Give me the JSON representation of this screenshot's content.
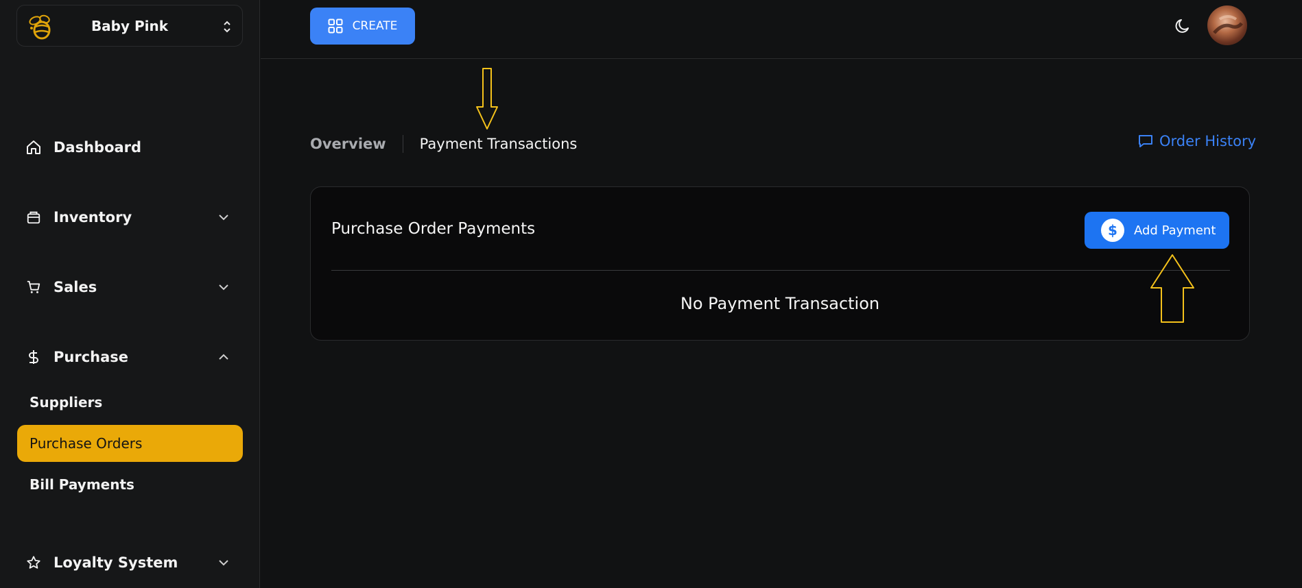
{
  "sidebar": {
    "store_name": "Baby Pink",
    "items": [
      {
        "label": "Dashboard",
        "icon": "home-icon"
      },
      {
        "label": "Inventory",
        "icon": "package-icon"
      },
      {
        "label": "Sales",
        "icon": "cart-icon"
      },
      {
        "label": "Purchase",
        "icon": "dollar-icon"
      },
      {
        "label": "Loyalty System",
        "icon": "star-icon"
      }
    ],
    "purchase_sub": [
      "Suppliers",
      "Purchase Orders",
      "Bill Payments"
    ],
    "active_sub": "Purchase Orders"
  },
  "topbar": {
    "create_label": "CREATE"
  },
  "tabs": {
    "overview": "Overview",
    "payment_transactions": "Payment Transactions",
    "order_history": "Order History"
  },
  "card": {
    "title": "Purchase Order Payments",
    "add_payment_label": "Add Payment",
    "empty_message": "No Payment Transaction"
  },
  "colors": {
    "background": "#111213",
    "sidebar": "#161718",
    "accent_blue": "#3b82f6",
    "active_yellow": "#eaa908",
    "annotation": "#f5c21b"
  }
}
